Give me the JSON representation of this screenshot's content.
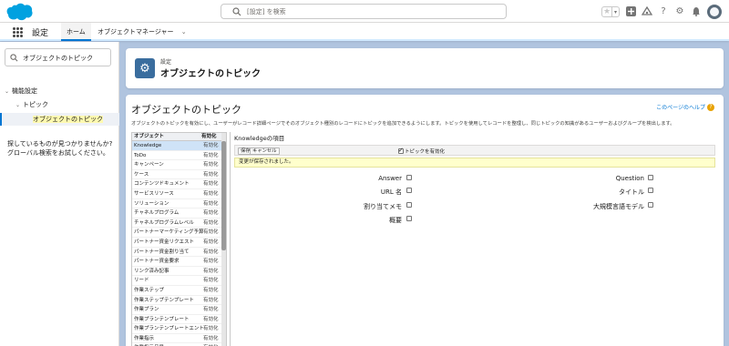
{
  "header": {
    "search_placeholder": "[設定] を検索"
  },
  "nav": {
    "app_name": "設定",
    "tab_home": "ホーム",
    "tab_object_manager": "オブジェクトマネージャー"
  },
  "sidebar": {
    "search_value": "オブジェクトのトピック",
    "tree": [
      "機能設定",
      "トピック",
      "オブジェクトのトピック"
    ],
    "help_line1": "探しているものが見つかりませんか?",
    "help_line2": "グローバル検索をお試しください。"
  },
  "page_header": {
    "breadcrumb": "設定",
    "title": "オブジェクトのトピック"
  },
  "content": {
    "title": "オブジェクトのトピック",
    "help_link": "このページのヘルプ",
    "description": "オブジェクトのトピックを有効にし、ユーザーがレコード詳細ページでそのオブジェクト種別のレコードにトピックを追加できるようにします。トピックを使用してレコードを整理し、同じトピックの知識があるユーザーおよびグループを検出します。",
    "table_headers": [
      "オブジェクト",
      "有効化"
    ],
    "objects": [
      {
        "name": "Knowledge",
        "status": "有効化"
      },
      {
        "name": "ToDo",
        "status": "有効化"
      },
      {
        "name": "キャンペーン",
        "status": "有効化"
      },
      {
        "name": "ケース",
        "status": "有効化"
      },
      {
        "name": "コンテンツドキュメント",
        "status": "有効化"
      },
      {
        "name": "サービスリソース",
        "status": "有効化"
      },
      {
        "name": "ソリューション",
        "status": "有効化"
      },
      {
        "name": "チャネルプログラム",
        "status": "有効化"
      },
      {
        "name": "チャネルプログラムレベル",
        "status": "有効化"
      },
      {
        "name": "パートナーマーケティング予算",
        "status": "有効化"
      },
      {
        "name": "パートナー資金リクエスト",
        "status": "有効化"
      },
      {
        "name": "パートナー資金割り当て",
        "status": "有効化"
      },
      {
        "name": "パートナー資金要求",
        "status": "有効化"
      },
      {
        "name": "リンク済み記事",
        "status": "有効化"
      },
      {
        "name": "リード",
        "status": "有効化"
      },
      {
        "name": "作業ステップ",
        "status": "有効化"
      },
      {
        "name": "作業ステップテンプレート",
        "status": "有効化"
      },
      {
        "name": "作業プラン",
        "status": "有効化"
      },
      {
        "name": "作業プランテンプレート",
        "status": "有効化"
      },
      {
        "name": "作業プランテンプレートエントリ",
        "status": "有効化"
      },
      {
        "name": "作業指示",
        "status": "有効化"
      },
      {
        "name": "作業指示品目",
        "status": "有効化"
      }
    ],
    "detail_title": "Knowledgeの項目",
    "save_button": "保存",
    "cancel_button": "キャンセル",
    "enable_label": "トピックを有効化",
    "saved_message": "変更が保存されました。",
    "fields_left": [
      "Answer",
      "URL 名",
      "割り当てメモ",
      "概要"
    ],
    "fields_right": [
      "Question",
      "タイトル",
      "大規模言語モデル"
    ]
  }
}
